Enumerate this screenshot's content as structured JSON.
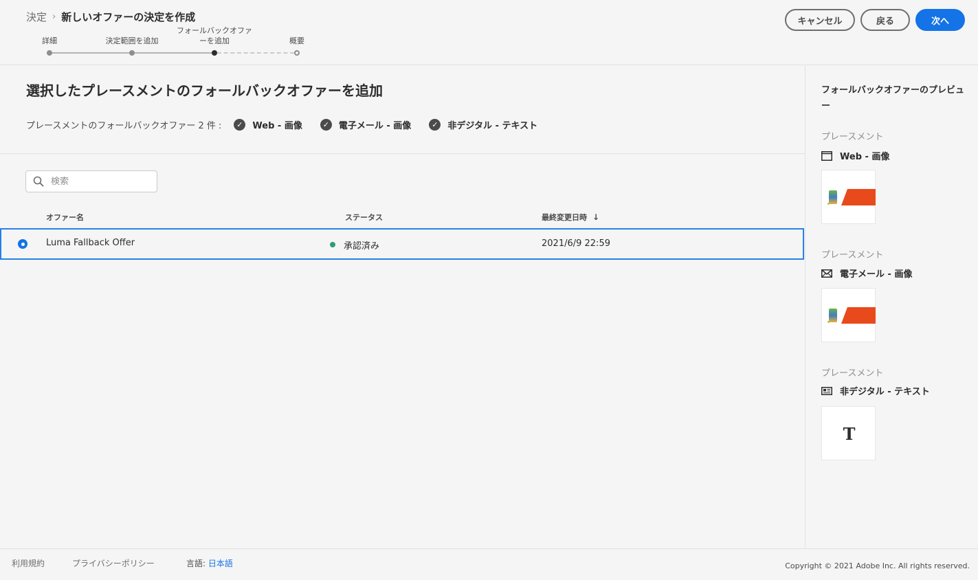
{
  "breadcrumb": {
    "parent": "決定",
    "separator": "›",
    "current": "新しいオファーの決定を作成"
  },
  "stepper": {
    "steps": [
      {
        "label": "詳細",
        "state": "done"
      },
      {
        "label": "決定範囲を追加",
        "state": "done"
      },
      {
        "label_line1": "フォールバックオファ",
        "label_line2": "ーを追加",
        "state": "current"
      },
      {
        "label": "概要",
        "state": "todo"
      }
    ]
  },
  "buttons": {
    "cancel": "キャンセル",
    "back": "戻る",
    "next": "次へ"
  },
  "main": {
    "title": "選択したプレースメントのフォールバックオファーを追加",
    "fallback_label": "プレースメントのフォールバックオファー 2 件 :",
    "fallback_items": [
      "Web - 画像",
      "電子メール - 画像",
      "非デジタル - テキスト"
    ]
  },
  "search": {
    "placeholder": "検索",
    "value": ""
  },
  "table": {
    "columns": [
      "オファー名",
      "ステータス",
      "最終変更日時"
    ],
    "sort_icon": "arrow-down-icon",
    "rows": [
      {
        "name": "Luma Fallback Offer",
        "status": "承認済み",
        "modified": "2021/6/9 22:59",
        "selected": true
      }
    ]
  },
  "preview": {
    "title": "フォールバックオファーのプレビュー",
    "placements": [
      {
        "label": "プレースメント",
        "name": "Web - 画像",
        "icon": "browser-window-icon"
      },
      {
        "label": "プレースメント",
        "name": "電子メール - 画像",
        "icon": "envelope-icon"
      },
      {
        "label": "プレースメント",
        "name": "非デジタル - テキスト",
        "icon": "newspaper-icon"
      }
    ],
    "text_glyph": "T"
  },
  "footer": {
    "terms": "利用規約",
    "privacy": "プライバシーポリシー",
    "language_label": "言語:",
    "language_value": "日本語",
    "copyright": "Copyright © 2021 Adobe Inc. All rights reserved."
  },
  "colors": {
    "accent": "#1473e6",
    "status_approved": "#2d9d78",
    "banner_red": "#e84a1c"
  }
}
